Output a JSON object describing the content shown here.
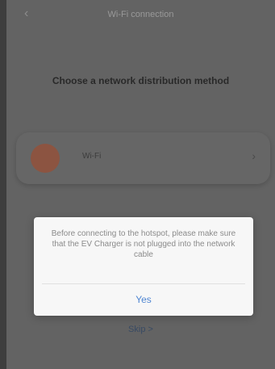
{
  "header": {
    "back_icon": "‹",
    "title": "Wi-Fi connection"
  },
  "main": {
    "subtitle": "Choose a network distribution method",
    "option": {
      "label": "Wi-Fi",
      "chevron_icon": "›"
    },
    "skip_label": "Skip >"
  },
  "dialog": {
    "message": "Before connecting to the hotspot, please make sure that the EV Charger is not plugged into the network cable",
    "confirm_label": "Yes"
  }
}
